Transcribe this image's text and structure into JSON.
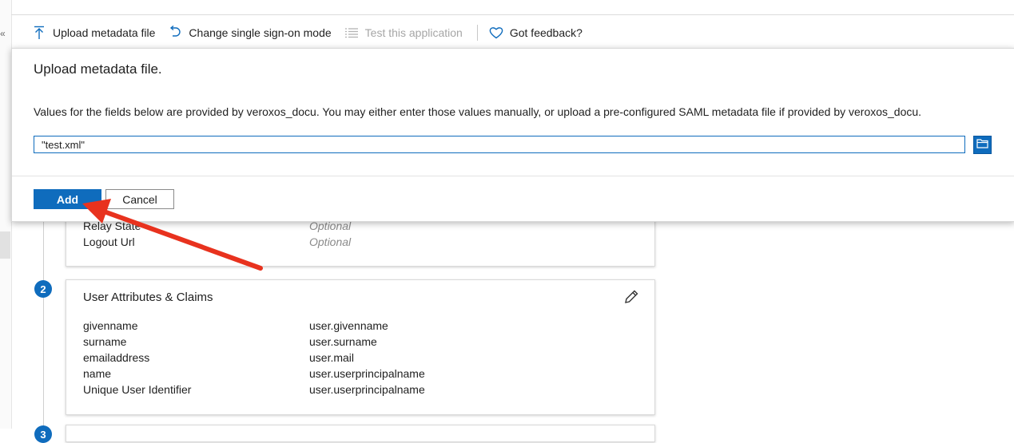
{
  "rail": {
    "collapse_glyph": "«"
  },
  "toolbar": {
    "upload_label": "Upload metadata file",
    "change_sso_label": "Change single sign-on mode",
    "test_label": "Test this application",
    "feedback_label": "Got feedback?"
  },
  "dialog": {
    "title": "Upload metadata file.",
    "description": "Values for the fields below are provided by veroxos_docu. You may either enter those values manually, or upload a pre-configured SAML metadata file if provided by veroxos_docu.",
    "file_value": "\"test.xml\"",
    "add_label": "Add",
    "cancel_label": "Cancel"
  },
  "card1": {
    "rows": [
      {
        "key": "Relay State",
        "value": "Optional"
      },
      {
        "key": "Logout Url",
        "value": "Optional"
      }
    ]
  },
  "card2": {
    "step": "2",
    "title": "User Attributes & Claims",
    "rows": [
      {
        "key": "givenname",
        "value": "user.givenname"
      },
      {
        "key": "surname",
        "value": "user.surname"
      },
      {
        "key": "emailaddress",
        "value": "user.mail"
      },
      {
        "key": "name",
        "value": "user.userprincipalname"
      },
      {
        "key": "Unique User Identifier",
        "value": "user.userprincipalname"
      }
    ]
  },
  "card3": {
    "step": "3"
  },
  "colors": {
    "accent": "#0f6cbd",
    "annotation_arrow": "#e8321e"
  },
  "icons": {
    "upload": "upload-arrow-icon",
    "change_sso": "undo-icon",
    "test": "list-icon",
    "feedback": "heart-icon",
    "browse": "folder-icon",
    "edit": "pencil-icon"
  }
}
